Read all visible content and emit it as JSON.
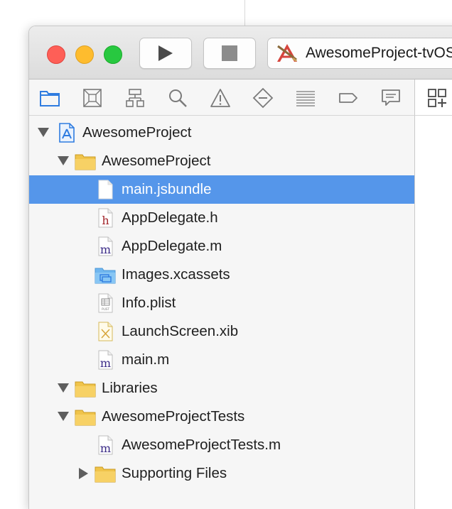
{
  "toolbar": {
    "scheme_label": "AwesomeProject-tvOS"
  },
  "navigator_tabs": [
    {
      "icon": "folder-icon",
      "selected": true
    },
    {
      "icon": "source-control-icon"
    },
    {
      "icon": "hierarchy-icon"
    },
    {
      "icon": "search-icon"
    },
    {
      "icon": "warning-icon"
    },
    {
      "icon": "test-diamond-icon"
    },
    {
      "icon": "debug-list-icon"
    },
    {
      "icon": "breakpoint-icon"
    },
    {
      "icon": "report-bubble-icon"
    }
  ],
  "tree": [
    {
      "label": "AwesomeProject",
      "icon": "project-icon",
      "disclosure": "expanded",
      "level": 0
    },
    {
      "label": "AwesomeProject",
      "icon": "group-folder-icon",
      "disclosure": "expanded",
      "level": 1
    },
    {
      "label": "main.jsbundle",
      "icon": "blank-file-icon",
      "level": 2,
      "selected": true
    },
    {
      "label": "AppDelegate.h",
      "icon": "header-file-icon",
      "level": 2
    },
    {
      "label": "AppDelegate.m",
      "icon": "objc-file-icon",
      "level": 2
    },
    {
      "label": "Images.xcassets",
      "icon": "asset-catalog-icon",
      "level": 2
    },
    {
      "label": "Info.plist",
      "icon": "plist-file-icon",
      "level": 2
    },
    {
      "label": "LaunchScreen.xib",
      "icon": "xib-file-icon",
      "level": 2
    },
    {
      "label": "main.m",
      "icon": "objc-file-icon",
      "level": 2
    },
    {
      "label": "Libraries",
      "icon": "group-folder-icon",
      "disclosure": "expanded",
      "level": 1
    },
    {
      "label": "AwesomeProjectTests",
      "icon": "group-folder-icon",
      "disclosure": "expanded",
      "level": 1
    },
    {
      "label": "AwesomeProjectTests.m",
      "icon": "objc-file-icon",
      "level": 2
    },
    {
      "label": "Supporting Files",
      "icon": "group-folder-icon",
      "disclosure": "collapsed",
      "level": 2
    }
  ],
  "icon_glyphs": {
    "header": "h",
    "objc": "m",
    "plist_tag": "PLIST"
  },
  "colors": {
    "selection": "#5596ea",
    "folder": "#f0c44b",
    "accent_blue": "#2f7ce0",
    "close": "#fe5f57",
    "minimize": "#febc2e",
    "zoom": "#28c840"
  }
}
